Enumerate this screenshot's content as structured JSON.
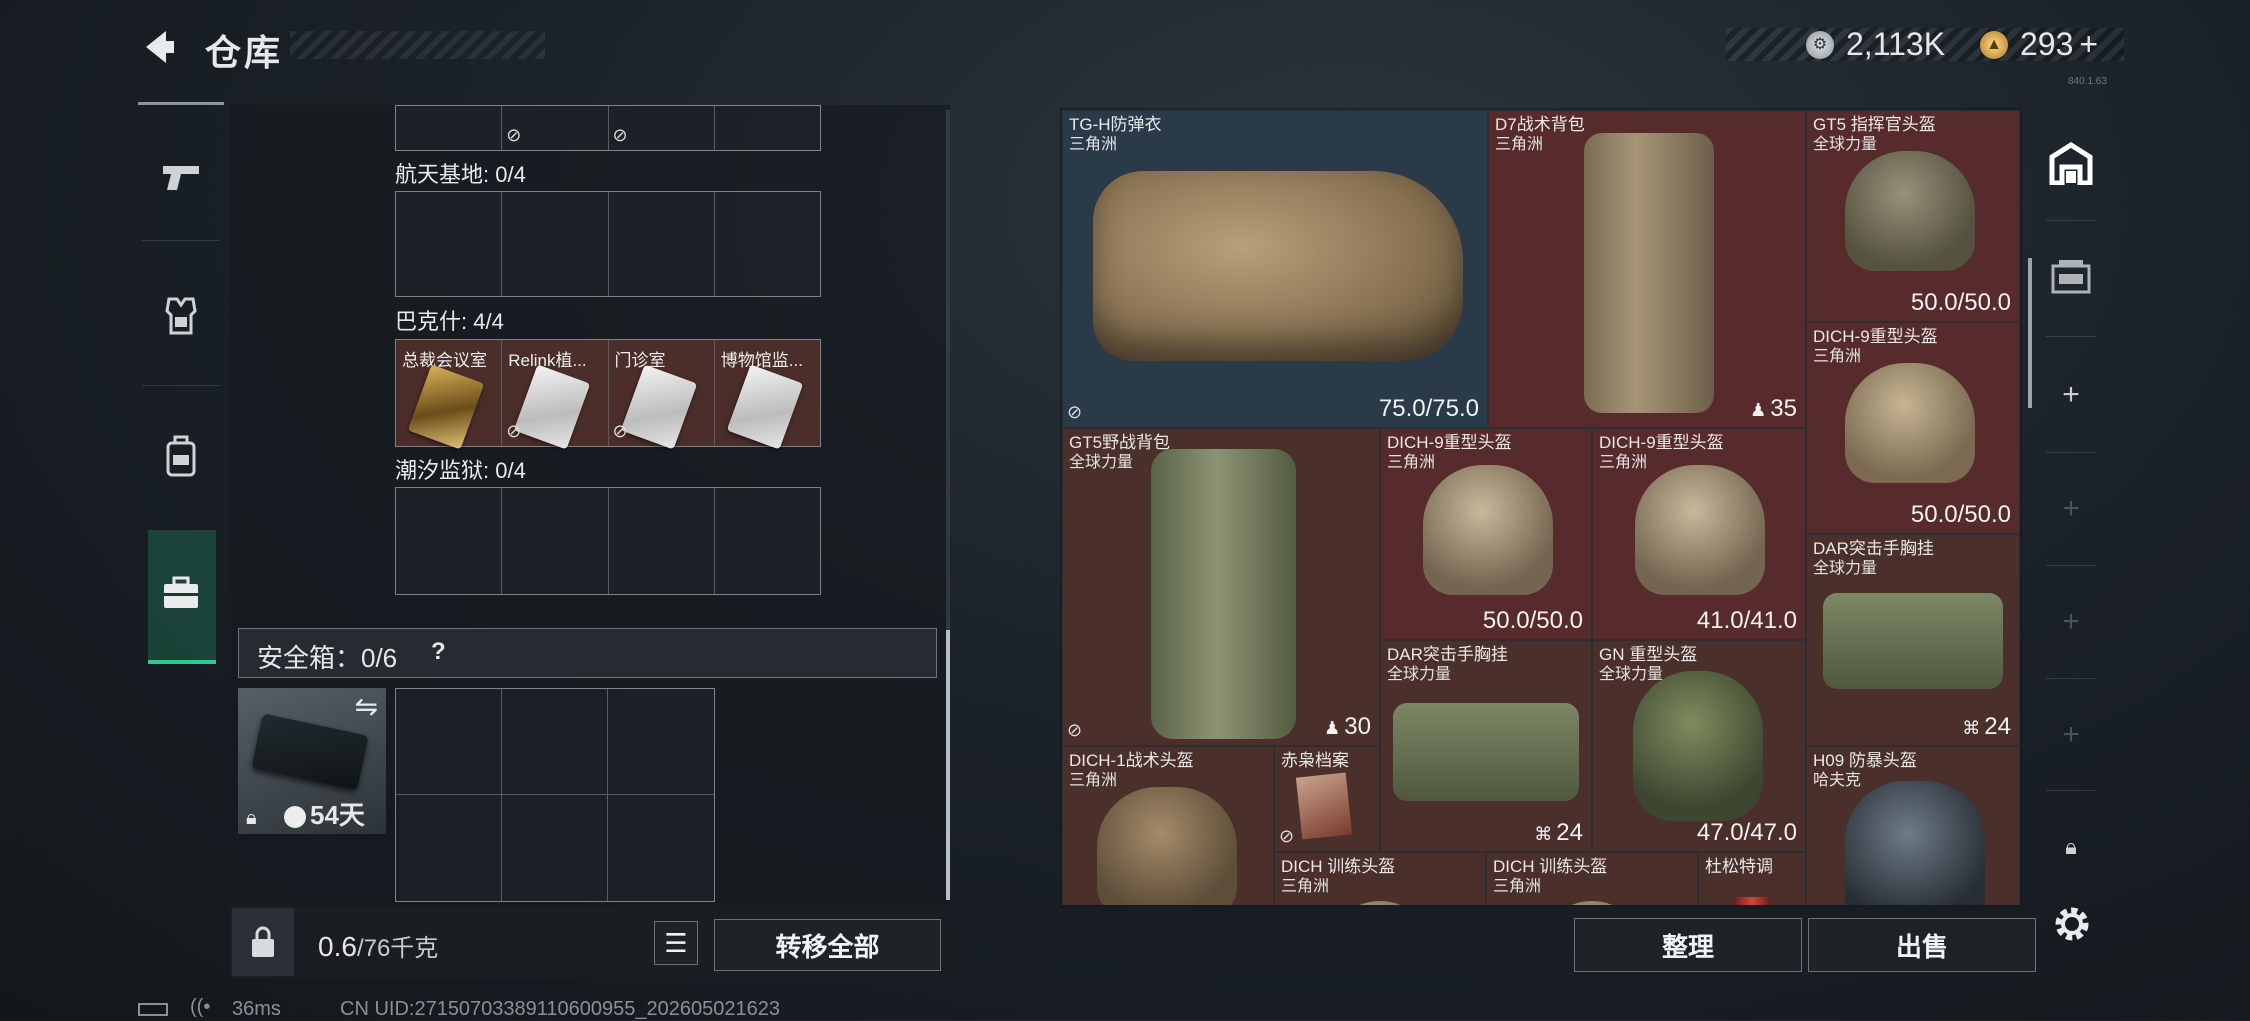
{
  "header": {
    "back_icon": "back-arrow-icon",
    "title": "仓库",
    "currency_silver": "2,113K",
    "currency_gold": "293",
    "currency_plus": "+"
  },
  "left_nav": {
    "items": [
      {
        "icon": "pistol-icon"
      },
      {
        "icon": "armor-vest-icon"
      },
      {
        "icon": "backpack-icon"
      },
      {
        "icon": "briefcase-icon",
        "active": true
      }
    ]
  },
  "collections": [
    {
      "label": "航天基地: 0/4",
      "cards": []
    },
    {
      "label": "巴克什: 4/4",
      "cards": [
        {
          "name": "总裁会议室",
          "style": "gold"
        },
        {
          "name": "Relink植...",
          "style": "silver"
        },
        {
          "name": "门诊室",
          "style": "silver"
        },
        {
          "name": "博物馆监...",
          "style": "silver"
        }
      ]
    },
    {
      "label": "潮汐监狱: 0/4",
      "cards": []
    }
  ],
  "safe_box": {
    "label": "安全箱：0/6",
    "help": "?",
    "timer": "54天"
  },
  "bottom_bar": {
    "weight_value": "0.6",
    "weight_max": "/76千克",
    "transfer_all": "转移全部"
  },
  "inventory": [
    {
      "name": "TG-H防弹衣",
      "sub": "三角洲",
      "value": "75.0/75.0",
      "color": "blue",
      "kind": "vest"
    },
    {
      "name": "D7战术背包",
      "sub": "三角洲",
      "value": "35",
      "color": "red",
      "kind": "backpack",
      "prefix": "♟"
    },
    {
      "name": "GT5 指挥官头盔",
      "sub": "全球力量",
      "value": "50.0/50.0",
      "color": "red",
      "kind": "helmet-nv"
    },
    {
      "name": "DICH-9重型头盔",
      "sub": "三角洲",
      "value": "50.0/50.0",
      "color": "red",
      "kind": "helmet"
    },
    {
      "name": "GT5野战背包",
      "sub": "全球力量",
      "value": "30",
      "color": "brown",
      "kind": "backpack-green",
      "prefix": "♟"
    },
    {
      "name": "DICH-9重型头盔",
      "sub": "三角洲",
      "value": "50.0/50.0",
      "color": "red",
      "kind": "helmet"
    },
    {
      "name": "DICH-9重型头盔",
      "sub": "三角洲",
      "value": "41.0/41.0",
      "color": "red",
      "kind": "helmet"
    },
    {
      "name": "DAR突击手胸挂",
      "sub": "全球力量",
      "value": "24",
      "color": "brown",
      "kind": "rig",
      "prefix": "⌘"
    },
    {
      "name": "DAR突击手胸挂",
      "sub": "全球力量",
      "value": "24",
      "color": "brown",
      "kind": "rig",
      "prefix": "⌘"
    },
    {
      "name": "GN 重型头盔",
      "sub": "全球力量",
      "value": "47.0/47.0",
      "color": "brown",
      "kind": "helmet-green"
    },
    {
      "name": "DICH-1战术头盔",
      "sub": "三角洲",
      "value": "",
      "color": "brown",
      "kind": "helmet-tan"
    },
    {
      "name": "赤枭档案",
      "sub": "",
      "value": "",
      "color": "brown",
      "kind": "doc"
    },
    {
      "name": "H09 防暴头盔",
      "sub": "哈夫克",
      "value": "",
      "color": "brown",
      "kind": "helmet-dark"
    },
    {
      "name": "DICH 训练头盔",
      "sub": "三角洲",
      "value": "",
      "color": "brown",
      "kind": "helmet"
    },
    {
      "name": "DICH 训练头盔",
      "sub": "三角洲",
      "value": "",
      "color": "brown",
      "kind": "helmet"
    },
    {
      "name": "杜松特调",
      "sub": "",
      "value": "",
      "color": "brown",
      "kind": "drink"
    }
  ],
  "right_sidebar": {
    "icons": [
      "home-storage-icon",
      "storage-box-icon",
      "plus-icon",
      "plus-icon",
      "plus-icon",
      "plus-icon",
      "lock-icon"
    ]
  },
  "actions": {
    "organize": "整理",
    "sell": "出售",
    "settings_icon": "gear-icon"
  },
  "status_bar": {
    "ping": "36ms",
    "uid": "CN UID:27150703389110600955_202605021623",
    "version": "840.1.63"
  },
  "colors": {
    "accent_green": "#31c98b",
    "rarity_red": "#572b2c",
    "rarity_blue": "#2a3a48",
    "rarity_brown": "#4a2f2a"
  }
}
